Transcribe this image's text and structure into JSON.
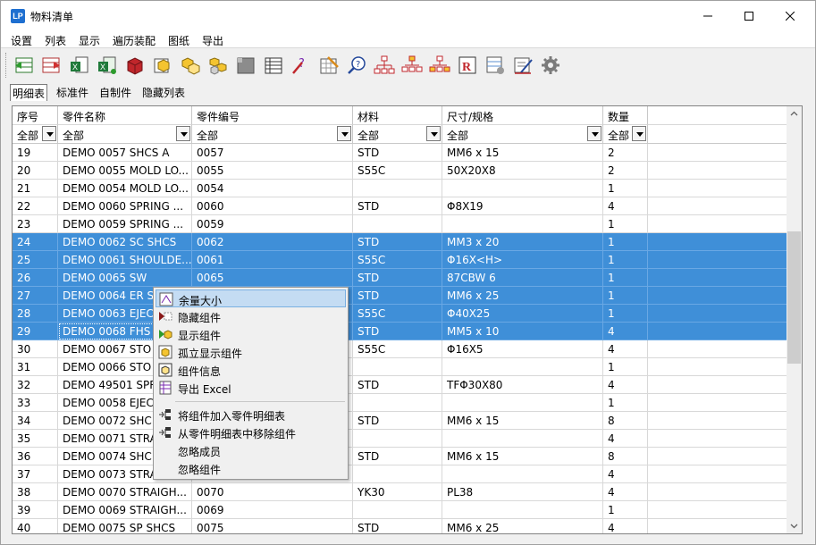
{
  "window": {
    "title": "物料清单",
    "app_icon": "app-logo-icon",
    "controls": [
      "minimize-icon",
      "maximize-icon",
      "close-icon"
    ]
  },
  "menubar": {
    "items": [
      "设置",
      "列表",
      "显示",
      "遍历装配",
      "图纸",
      "导出"
    ]
  },
  "toolbar": {
    "icons": [
      "expand-rows-icon",
      "collapse-rows-icon",
      "excel-export-icon",
      "excel-import-icon",
      "red-box-icon",
      "part-icon",
      "sub-assembly-icon",
      "assembly-icon",
      "gray-block-icon",
      "table-icon",
      "question-pen-icon",
      "grid-pen-icon",
      "zoom-help-icon",
      "tree-icon",
      "tree-expand-icon",
      "tree-collapse-icon",
      "report-icon",
      "sheet-settings-icon",
      "edit-sheet-icon",
      "gear-icon"
    ]
  },
  "tabs": [
    {
      "label": "明细表",
      "active": true
    },
    {
      "label": "标准件",
      "active": false
    },
    {
      "label": "自制件",
      "active": false
    },
    {
      "label": "隐藏列表",
      "active": false
    }
  ],
  "table": {
    "columns": [
      "序号",
      "零件名称",
      "零件编号",
      "材料",
      "尺寸/规格",
      "数量"
    ],
    "filters": [
      "全部",
      "全部",
      "全部",
      "全部",
      "全部",
      "全部"
    ],
    "rows": [
      {
        "no": "19",
        "name": "DEMO 0057 SHCS A",
        "code": "0057",
        "material": "STD",
        "size": "MM6 x 15",
        "qty": "2",
        "selected": false
      },
      {
        "no": "20",
        "name": "DEMO 0055 MOLD LO...",
        "code": "0055",
        "material": "S55C",
        "size": "50X20X8",
        "qty": "2",
        "selected": false
      },
      {
        "no": "21",
        "name": "DEMO 0054 MOLD LO...",
        "code": "0054",
        "material": "",
        "size": "",
        "qty": "1",
        "selected": false
      },
      {
        "no": "22",
        "name": "DEMO 0060 SPRING ...",
        "code": "0060",
        "material": "STD",
        "size": "Φ8X19",
        "qty": "4",
        "selected": false
      },
      {
        "no": "23",
        "name": "DEMO 0059 SPRING ...",
        "code": "0059",
        "material": "",
        "size": "",
        "qty": "1",
        "selected": false
      },
      {
        "no": "24",
        "name": "DEMO 0062 SC SHCS",
        "code": "0062",
        "material": "STD",
        "size": "MM3 x 20",
        "qty": "1",
        "selected": true
      },
      {
        "no": "25",
        "name": "DEMO 0061 SHOULDE...",
        "code": "0061",
        "material": "S55C",
        "size": "Φ16X<H>",
        "qty": "1",
        "selected": true
      },
      {
        "no": "26",
        "name": "DEMO 0065 SW",
        "code": "0065",
        "material": "STD",
        "size": "87CBW 6",
        "qty": "1",
        "selected": true
      },
      {
        "no": "27",
        "name": "DEMO 0064 ER S",
        "code": "",
        "material": "STD",
        "size": "MM6 x 25",
        "qty": "1",
        "selected": true
      },
      {
        "no": "28",
        "name": "DEMO 0063 EJEC",
        "code": "",
        "material": "S55C",
        "size": "Φ40X25",
        "qty": "1",
        "selected": true
      },
      {
        "no": "29",
        "name": "DEMO 0068 FHS",
        "code": "",
        "material": "STD",
        "size": "MM5 x 10",
        "qty": "4",
        "selected": true
      },
      {
        "no": "30",
        "name": "DEMO 0067 STO",
        "code": "",
        "material": "S55C",
        "size": "Φ16X5",
        "qty": "4",
        "selected": false
      },
      {
        "no": "31",
        "name": "DEMO 0066 STO",
        "code": "",
        "material": "",
        "size": "",
        "qty": "1",
        "selected": false
      },
      {
        "no": "32",
        "name": "DEMO 49501 SPR",
        "code": "",
        "material": "STD",
        "size": "TFΦ30X80",
        "qty": "4",
        "selected": false
      },
      {
        "no": "33",
        "name": "DEMO 0058 EJEC",
        "code": "",
        "material": "",
        "size": "",
        "qty": "1",
        "selected": false
      },
      {
        "no": "34",
        "name": "DEMO 0072 SHC",
        "code": "",
        "material": "STD",
        "size": "MM6 x 15",
        "qty": "8",
        "selected": false
      },
      {
        "no": "35",
        "name": "DEMO 0071 STRA",
        "code": "",
        "material": "",
        "size": "",
        "qty": "4",
        "selected": false
      },
      {
        "no": "36",
        "name": "DEMO 0074 SHC",
        "code": "",
        "material": "STD",
        "size": "MM6 x 15",
        "qty": "8",
        "selected": false
      },
      {
        "no": "37",
        "name": "DEMO 0073 STRA",
        "code": "",
        "material": "",
        "size": "",
        "qty": "4",
        "selected": false
      },
      {
        "no": "38",
        "name": "DEMO 0070 STRAIGH...",
        "code": "0070",
        "material": "YK30",
        "size": "PL38",
        "qty": "4",
        "selected": false
      },
      {
        "no": "39",
        "name": "DEMO 0069 STRAIGH...",
        "code": "0069",
        "material": "",
        "size": "",
        "qty": "1",
        "selected": false
      },
      {
        "no": "40",
        "name": "DEMO 0075 SP SHCS",
        "code": "0075",
        "material": "STD",
        "size": "MM6 x 25",
        "qty": "4",
        "selected": false
      }
    ]
  },
  "context_menu": {
    "items": [
      {
        "label": "余量大小",
        "icon": "margin-size-icon",
        "highlighted": true
      },
      {
        "label": "隐藏组件",
        "icon": "hide-component-icon",
        "highlighted": false
      },
      {
        "label": "显示组件",
        "icon": "show-component-icon",
        "highlighted": false
      },
      {
        "label": "孤立显示组件",
        "icon": "isolate-component-icon",
        "highlighted": false
      },
      {
        "label": "组件信息",
        "icon": "component-info-icon",
        "highlighted": false
      },
      {
        "label": "导出 Excel",
        "icon": "export-excel-icon",
        "highlighted": false
      },
      {
        "label": "将组件加入零件明细表",
        "icon": "add-to-bom-icon",
        "highlighted": false
      },
      {
        "label": "从零件明细表中移除组件",
        "icon": "remove-from-bom-icon",
        "highlighted": false
      },
      {
        "label": "忽略成员",
        "icon": "",
        "highlighted": false
      },
      {
        "label": "忽略组件",
        "icon": "",
        "highlighted": false
      }
    ]
  },
  "colors": {
    "selection": "#3f8fd8",
    "menu_highlight": "#c4dcf3"
  }
}
